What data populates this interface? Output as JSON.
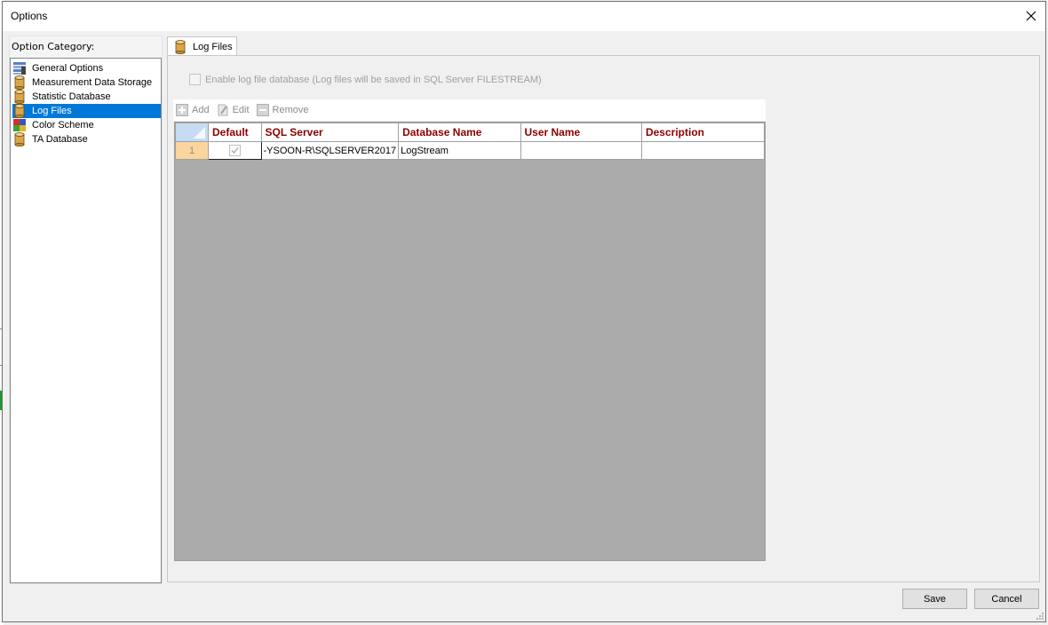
{
  "window": {
    "title": "Options"
  },
  "category": {
    "label": "Option Category:",
    "items": [
      {
        "label": "General Options",
        "icon": "general-options-icon"
      },
      {
        "label": "Measurement Data Storage",
        "icon": "database-icon"
      },
      {
        "label": "Statistic Database",
        "icon": "database-icon"
      },
      {
        "label": "Log Files",
        "icon": "database-icon",
        "selected": true
      },
      {
        "label": "Color Scheme",
        "icon": "color-scheme-icon"
      },
      {
        "label": "TA Database",
        "icon": "database-icon"
      }
    ]
  },
  "tab": {
    "label": "Log Files"
  },
  "enable_log": {
    "label": "Enable log file database (Log files will be saved in SQL Server FILESTREAM)",
    "checked": false
  },
  "toolbar": {
    "add": "Add",
    "edit": "Edit",
    "remove": "Remove"
  },
  "grid": {
    "columns": [
      "Default",
      "SQL Server",
      "Database Name",
      "User Name",
      "Description"
    ],
    "rows": [
      {
        "row_number": "1",
        "default": true,
        "sql_server": "-YSOON-R\\SQLSERVER2017",
        "database_name": "LogStream",
        "user_name": "",
        "description": ""
      }
    ]
  },
  "buttons": {
    "save": "Save",
    "cancel": "Cancel"
  },
  "colors": {
    "selection": "#0078d7",
    "header_text": "#8b0000",
    "grid_background": "#ababab",
    "row_header": "#fad69e"
  }
}
